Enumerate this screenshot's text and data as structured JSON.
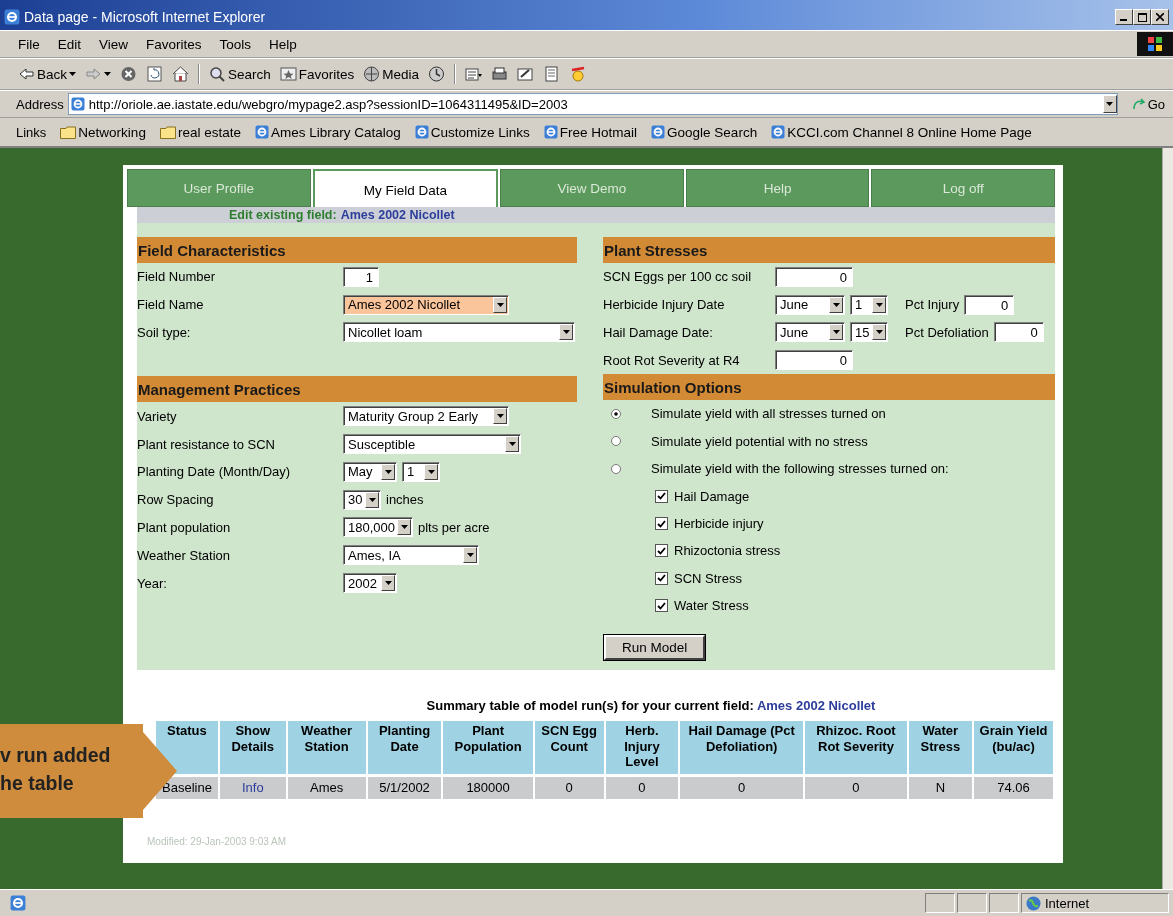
{
  "window": {
    "title": "Data page - Microsoft Internet Explorer"
  },
  "menu": [
    "File",
    "Edit",
    "View",
    "Favorites",
    "Tools",
    "Help"
  ],
  "toolbar": [
    {
      "kind": "back",
      "label": "Back"
    },
    {
      "kind": "forward"
    },
    {
      "kind": "stop"
    },
    {
      "kind": "refresh"
    },
    {
      "kind": "home"
    },
    {
      "kind": "search",
      "label": "Search"
    },
    {
      "kind": "favorites",
      "label": "Favorites"
    },
    {
      "kind": "media",
      "label": "Media"
    },
    {
      "kind": "history"
    },
    {
      "kind": "mail"
    },
    {
      "kind": "print"
    },
    {
      "kind": "edit"
    },
    {
      "kind": "discuss"
    },
    {
      "kind": "messenger"
    }
  ],
  "address": {
    "label": "Address",
    "url": "http://oriole.ae.iastate.edu/webgro/mypage2.asp?sessionID=1064311495&ID=2003",
    "go": "Go"
  },
  "links": {
    "label": "Links",
    "items": [
      {
        "kind": "folder",
        "label": "Networking"
      },
      {
        "kind": "folder",
        "label": "real estate"
      },
      {
        "kind": "page",
        "label": "Ames Library Catalog"
      },
      {
        "kind": "page",
        "label": "Customize Links"
      },
      {
        "kind": "page",
        "label": "Free Hotmail"
      },
      {
        "kind": "page",
        "label": "Google Search"
      },
      {
        "kind": "page",
        "label": "KCCI.com Channel 8 Online Home Page"
      }
    ]
  },
  "tabs": [
    {
      "label": "User Profile",
      "selected": false
    },
    {
      "label": "My Field Data",
      "selected": true
    },
    {
      "label": "View Demo",
      "selected": false
    },
    {
      "label": "Help",
      "selected": false
    },
    {
      "label": "Log off",
      "selected": false
    }
  ],
  "edit_banner": {
    "label": "Edit existing field:",
    "field": "Ames 2002 Nicollet"
  },
  "field_characteristics": {
    "title": "Field Characteristics",
    "rows": [
      {
        "label": "Field Number",
        "controls": [
          {
            "kind": "input",
            "value": "1"
          }
        ]
      },
      {
        "label": "Field Name",
        "controls": [
          {
            "kind": "select",
            "value": "Ames 2002 Nicollet",
            "highlighted": true
          }
        ]
      },
      {
        "label": "Soil type:",
        "controls": [
          {
            "kind": "select",
            "value": "Nicollet loam",
            "highlighted": false
          }
        ]
      }
    ]
  },
  "management_practices": {
    "title": "Management Practices",
    "rows": [
      {
        "label": "Variety",
        "controls": [
          {
            "kind": "select",
            "value": "Maturity Group 2 Early",
            "highlighted": false
          }
        ]
      },
      {
        "label": "Plant resistance to SCN",
        "controls": [
          {
            "kind": "select",
            "value": "Susceptible",
            "highlighted": false
          }
        ]
      },
      {
        "label": "Planting Date (Month/Day)",
        "controls": [
          {
            "kind": "select",
            "value": "May",
            "highlighted": false
          },
          {
            "kind": "select",
            "value": "1",
            "highlighted": false
          }
        ]
      },
      {
        "label": "Row Spacing",
        "controls": [
          {
            "kind": "select",
            "value": "30",
            "highlighted": false
          },
          {
            "kind": "text",
            "value": "inches"
          }
        ]
      },
      {
        "label": "Plant population",
        "controls": [
          {
            "kind": "select",
            "value": "180,000",
            "highlighted": false
          },
          {
            "kind": "text",
            "value": "plts per acre"
          }
        ]
      },
      {
        "label": "Weather Station",
        "controls": [
          {
            "kind": "select",
            "value": "Ames, IA",
            "highlighted": false
          }
        ]
      },
      {
        "label": "Year:",
        "controls": [
          {
            "kind": "select",
            "value": "2002",
            "highlighted": false
          }
        ]
      }
    ]
  },
  "plant_stresses": {
    "title": "Plant Stresses",
    "rows": [
      {
        "label": "SCN Eggs per 100 cc soil",
        "controls": [
          {
            "kind": "input",
            "value": "0"
          }
        ]
      },
      {
        "label": "Herbicide Injury Date",
        "controls": [
          {
            "kind": "select",
            "value": "June",
            "highlighted": false
          },
          {
            "kind": "select",
            "value": "1",
            "highlighted": false
          },
          {
            "kind": "text",
            "value": "Pct Injury"
          },
          {
            "kind": "input",
            "value": "0"
          }
        ]
      },
      {
        "label": "Hail Damage Date:",
        "controls": [
          {
            "kind": "select",
            "value": "June",
            "highlighted": false
          },
          {
            "kind": "select",
            "value": "15",
            "highlighted": false
          },
          {
            "kind": "text",
            "value": "Pct Defoliation"
          },
          {
            "kind": "input",
            "value": "0"
          }
        ]
      },
      {
        "label": "Root Rot Severity at R4",
        "controls": [
          {
            "kind": "input",
            "value": "0"
          }
        ]
      }
    ]
  },
  "simulation_options": {
    "title": "Simulation Options",
    "radios": [
      {
        "label": "Simulate yield with all stresses turned on",
        "selected": true
      },
      {
        "label": "Simulate yield potential with no stress",
        "selected": false
      },
      {
        "label": "Simulate yield with the following stresses turned on:",
        "selected": false
      }
    ],
    "checkboxes": [
      {
        "label": "Hail Damage",
        "checked": true
      },
      {
        "label": "Herbicide injury",
        "checked": true
      },
      {
        "label": "Rhizoctonia stress",
        "checked": true
      },
      {
        "label": "SCN Stress",
        "checked": true
      },
      {
        "label": "Water Stress",
        "checked": true
      }
    ],
    "button": "Run Model"
  },
  "summary": {
    "title": "Summary table of model run(s) for your current field:",
    "field": "Ames 2002 Nicollet",
    "columns": [
      "Status",
      "Show Details",
      "Weather Station",
      "Planting Date",
      "Plant Population",
      "SCN Egg Count",
      "Herb. Injury Level",
      "Hail Damage (Pct Defoliation)",
      "Rhizoc. Root Rot Severity",
      "Water Stress",
      "Grain Yield (bu/ac)"
    ],
    "rows": [
      {
        "cells": [
          {
            "text": "Baseline",
            "kind": "plain"
          },
          {
            "text": "Info",
            "kind": "link"
          },
          {
            "text": "Ames",
            "kind": "plain"
          },
          {
            "text": "5/1/2002",
            "kind": "plain"
          },
          {
            "text": "180000",
            "kind": "plain"
          },
          {
            "text": "0",
            "kind": "plain"
          },
          {
            "text": "0",
            "kind": "plain"
          },
          {
            "text": "0",
            "kind": "plain"
          },
          {
            "text": "0",
            "kind": "plain"
          },
          {
            "text": "N",
            "kind": "plain"
          },
          {
            "text": "74.06",
            "kind": "plain"
          }
        ]
      }
    ]
  },
  "modified": "Modified: 29-Jan-2003 9:03 AM",
  "callout": {
    "lines": [
      "v run added",
      "he table"
    ]
  },
  "status_bar": {
    "zone": "Internet"
  }
}
